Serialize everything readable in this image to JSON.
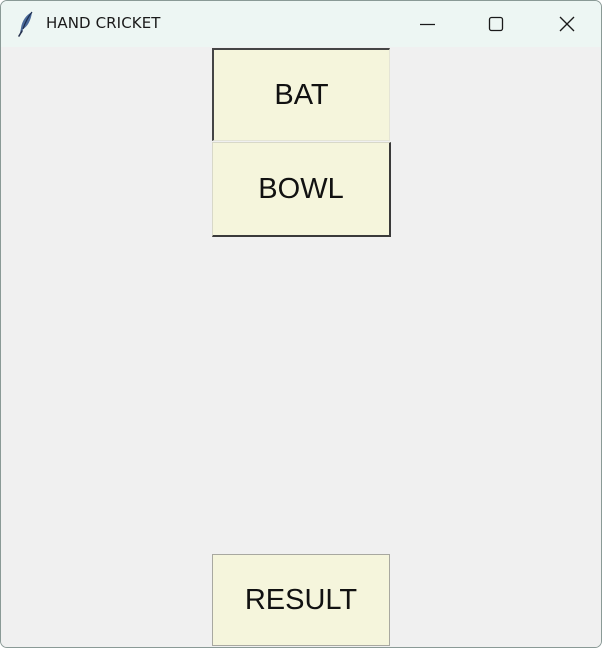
{
  "window": {
    "title": "HAND CRICKET",
    "app_icon": "feather-icon",
    "controls": {
      "minimize_icon": "minimize-icon",
      "maximize_icon": "maximize-icon",
      "close_icon": "close-icon"
    }
  },
  "buttons": {
    "bat_label": "BAT",
    "bowl_label": "BOWL",
    "result_label": "RESULT"
  },
  "colors": {
    "window_background": "#f0f0f0",
    "titlebar_background": "#edf6f3",
    "button_background": "#f5f5dc",
    "button_text": "#111111"
  }
}
